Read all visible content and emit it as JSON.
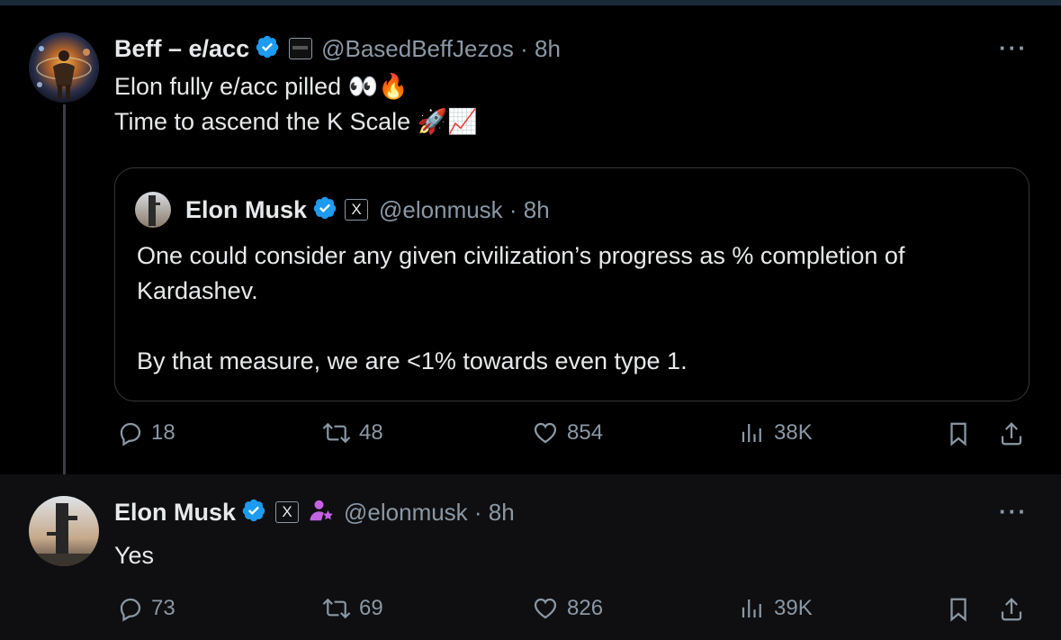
{
  "tweet1": {
    "name": "Beff – e/acc",
    "handle": "@BasedBeffJezos · 8h",
    "line1": "Elon fully e/acc pilled 👀🔥",
    "line2": "Time to ascend the K Scale 🚀📈",
    "quote": {
      "name": "Elon Musk",
      "handle": "@elonmusk · 8h",
      "badge": "X",
      "line1": "One could consider any given civilization’s progress as % completion of",
      "line2": "Kardashev.",
      "line3": "By that measure, we are <1% towards even type 1."
    },
    "replies": "18",
    "reposts": "48",
    "likes": "854",
    "views": "38K"
  },
  "tweet2": {
    "name": "Elon Musk",
    "badge": "X",
    "handle": "@elonmusk · 8h",
    "text": "Yes",
    "replies": "73",
    "reposts": "69",
    "likes": "826",
    "views": "39K"
  },
  "more_label": "···",
  "colors": {
    "verified": "#1d9bf0",
    "muted": "#8b98a5",
    "text": "#e7e9ea"
  },
  "icons": [
    "verified-icon",
    "reply-icon",
    "repost-icon",
    "like-icon",
    "views-icon",
    "bookmark-icon",
    "share-icon",
    "more-icon"
  ]
}
